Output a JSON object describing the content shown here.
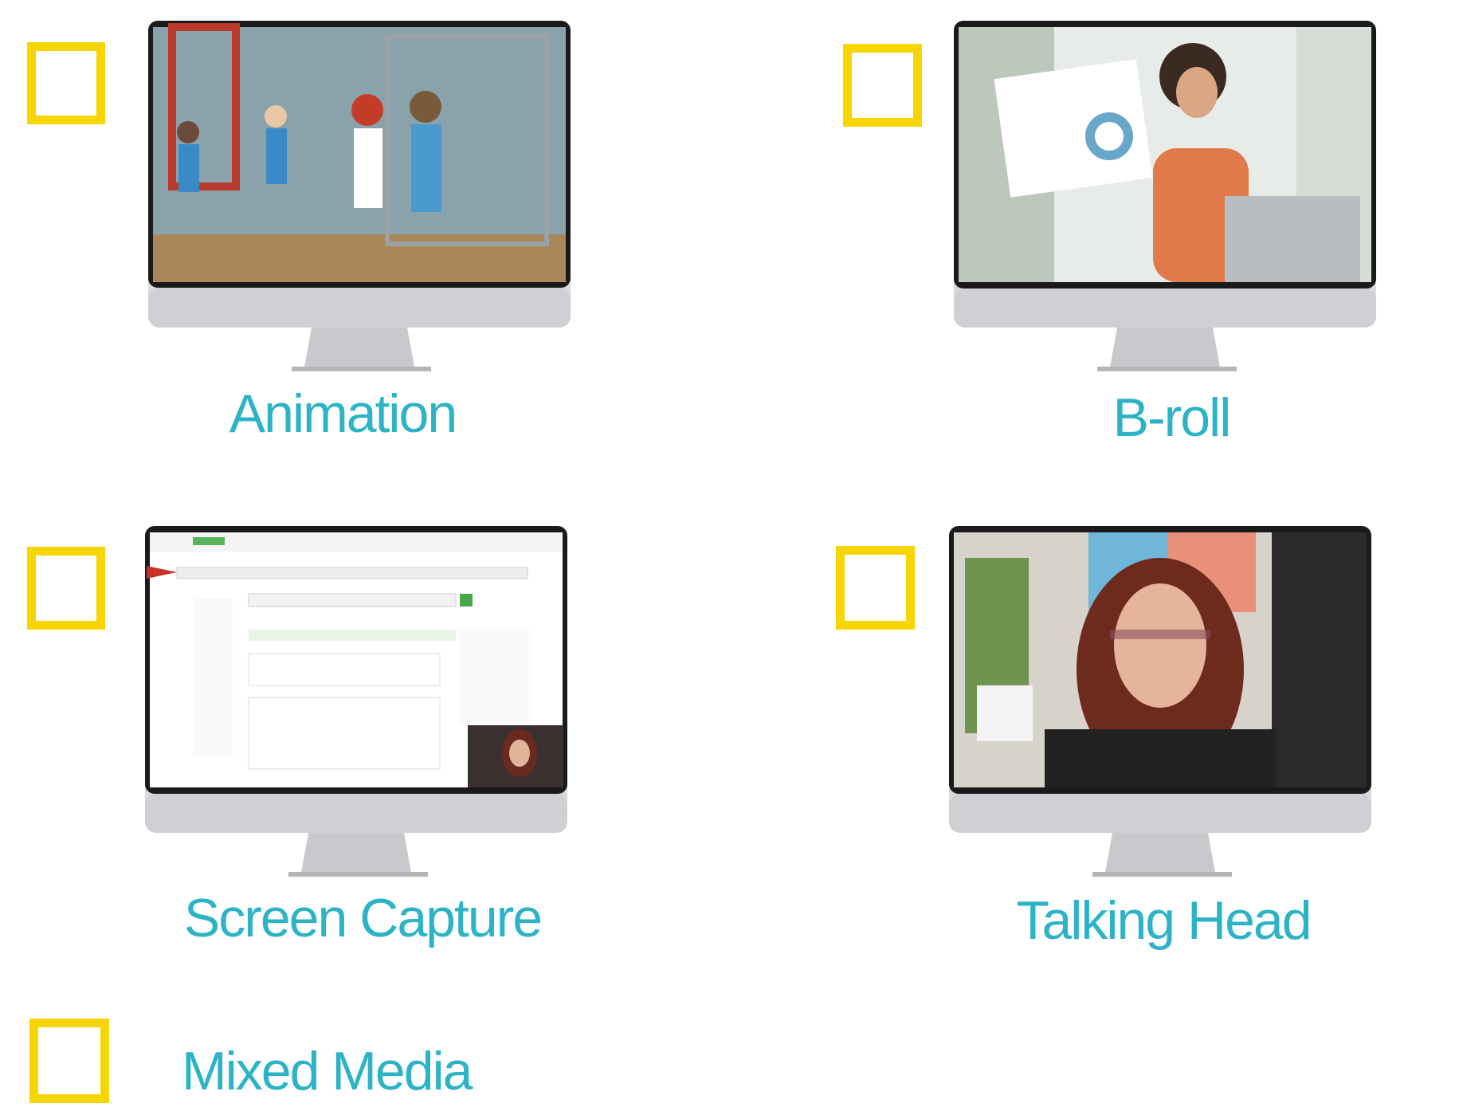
{
  "options": [
    {
      "id": "animation",
      "label": "Animation",
      "checked": false
    },
    {
      "id": "broll",
      "label": "B-roll",
      "checked": false
    },
    {
      "id": "screen",
      "label": "Screen Capture",
      "checked": false
    },
    {
      "id": "talking",
      "label": "Talking Head",
      "checked": false
    },
    {
      "id": "mixed",
      "label": "Mixed Media",
      "checked": false
    }
  ],
  "colors": {
    "checkbox_border": "#f7d500",
    "label": "#2cb3c6"
  }
}
